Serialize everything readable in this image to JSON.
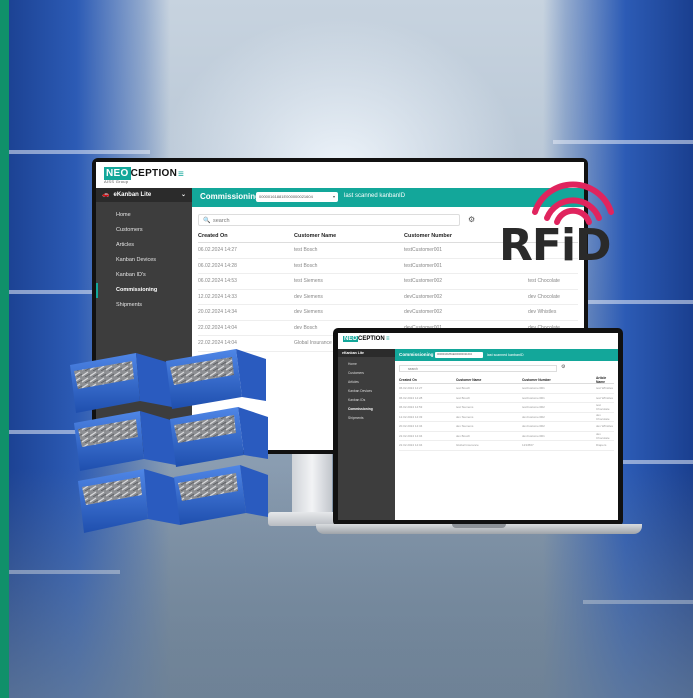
{
  "colors": {
    "accent": "#13a79a",
    "sidebar": "#3d3d3d",
    "rfid_waves": "#e0245e",
    "bin_blue": "#2f63c8",
    "left_strip": "#10906a"
  },
  "rfid_logo": {
    "text": "RFiD"
  },
  "monitor": {
    "logo": {
      "neo": "NEO",
      "rest": "CEPTION",
      "tagline": "AISS Group"
    },
    "hamburger_icon": "≡",
    "sidebar": {
      "header": "eKanban Lite",
      "items": [
        {
          "label": "Home"
        },
        {
          "label": "Customers"
        },
        {
          "label": "Articles"
        },
        {
          "label": "Kanban Devices"
        },
        {
          "label": "Kanban ID's"
        },
        {
          "label": "Commissioning",
          "active": true
        },
        {
          "label": "Shipments"
        }
      ]
    },
    "commissioning": {
      "title": "Commissioning",
      "select_value": "00000161881E000000021604",
      "scan_text": "last scanned kanbanID"
    },
    "search": {
      "placeholder": "search"
    },
    "table": {
      "headers": [
        "Created On",
        "Customer Name",
        "Customer Number",
        ""
      ],
      "rows": [
        [
          "06.02.2024 14:27",
          "test Bosch",
          "testCustomer001",
          ""
        ],
        [
          "06.02.2024 14:28",
          "test Bosch",
          "testCustomer001",
          ""
        ],
        [
          "06.02.2024 14:53",
          "test Siemens",
          "testCustomer002",
          "test Chocolate"
        ],
        [
          "12.02.2024 14:33",
          "dev Siemens",
          "devCustomer002",
          "dev Chocolate"
        ],
        [
          "20.02.2024 14:34",
          "dev Siemens",
          "devCustomer002",
          "dev Whistles"
        ],
        [
          "22.02.2024 14:04",
          "dev Bosch",
          "devCustomer001",
          "dev Chocolate"
        ],
        [
          "22.02.2024 14:04",
          "Global Insurance",
          "",
          ""
        ]
      ]
    }
  },
  "laptop": {
    "logo": {
      "neo": "NEO",
      "rest": "CEPTION"
    },
    "sidebar": {
      "header": "eKanban Lite",
      "items": [
        {
          "label": "Home"
        },
        {
          "label": "Customers"
        },
        {
          "label": "Articles"
        },
        {
          "label": "Kanban Devices"
        },
        {
          "label": "Kanban IDs"
        },
        {
          "label": "Commissioning",
          "active": true
        },
        {
          "label": "Shipments"
        }
      ]
    },
    "commissioning": {
      "title": "Commissioning",
      "select_value": "00000161881E000000021604",
      "scan_text": "last scanned kanbanID"
    },
    "search": {
      "placeholder": "search"
    },
    "table": {
      "headers": [
        "Created On",
        "Customer Name",
        "Customer Number",
        "Article Name"
      ],
      "rows": [
        [
          "06.02.2024 14:27",
          "test Bosch",
          "testCustomer001",
          "test Whistles"
        ],
        [
          "06.02.2024 14:28",
          "test Bosch",
          "testCustomer001",
          "test Whistles"
        ],
        [
          "06.02.2024 14:53",
          "test Siemens",
          "testCustomer002",
          "test Chocolate"
        ],
        [
          "12.02.2024 14:33",
          "dev Siemens",
          "devCustomer002",
          "dev Chocolate"
        ],
        [
          "20.02.2024 14:34",
          "dev Siemens",
          "devCustomer002",
          "dev Whistles"
        ],
        [
          "22.02.2024 14:04",
          "dev Bosch",
          "devCustomer001",
          "dev Chocolate"
        ],
        [
          "22.02.2024 14:04",
          "Global Insurance",
          "1234567",
          "Diapers"
        ]
      ]
    }
  }
}
